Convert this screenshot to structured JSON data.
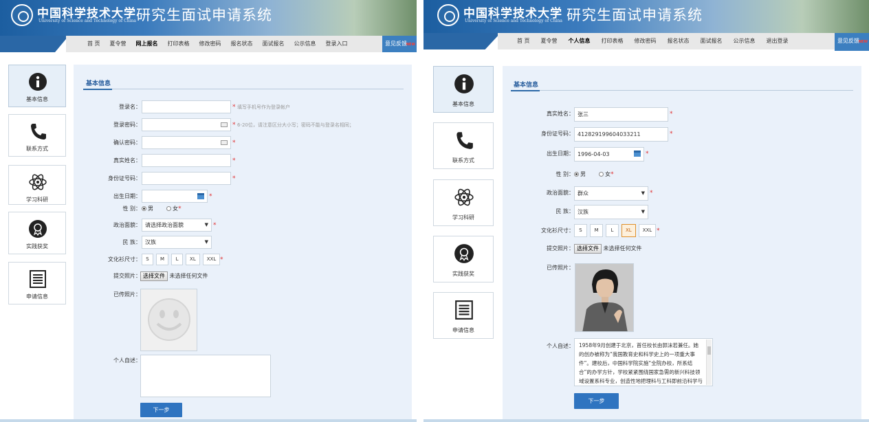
{
  "left": {
    "header": {
      "university_cn": "中国科学技术大学",
      "university_en": "University of Science and Technology of China",
      "system_title": "研究生面试申请系统"
    },
    "nav": {
      "items": [
        "首 页",
        "夏令营",
        "网上报名",
        "打印表格",
        "修改密码",
        "报名状态",
        "面试报名",
        "公示信息",
        "登录入口"
      ],
      "active_index": 2,
      "feedback": "意见反馈",
      "feedback_badge": "NEW"
    },
    "sidebar": [
      {
        "label": "基本信息",
        "icon": "info-icon"
      },
      {
        "label": "联系方式",
        "icon": "phone-icon"
      },
      {
        "label": "学习科研",
        "icon": "atom-icon"
      },
      {
        "label": "实践获奖",
        "icon": "award-icon"
      },
      {
        "label": "申请信息",
        "icon": "document-icon"
      }
    ],
    "section_title": "基本信息",
    "form": {
      "username": {
        "label": "登录名：",
        "value": "",
        "hint": "填写手机号作为登录帐户"
      },
      "password": {
        "label": "登录密码：",
        "value": "",
        "hint": "6-20位，请注意区分大小写；密码不能与登录名相同；"
      },
      "confirm_password": {
        "label": "确认密码：",
        "value": ""
      },
      "real_name": {
        "label": "真实姓名：",
        "value": ""
      },
      "id_number": {
        "label": "身份证号码：",
        "value": ""
      },
      "birth_date": {
        "label": "出生日期：",
        "value": ""
      },
      "gender": {
        "label": "性 别：",
        "options": [
          "男",
          "女"
        ],
        "selected": "男"
      },
      "political_status": {
        "label": "政治面貌：",
        "value": "请选择政治面貌"
      },
      "ethnicity": {
        "label": "民 族：",
        "value": "汉族"
      },
      "shirt_size": {
        "label": "文化衫尺寸：",
        "options": [
          "S",
          "M",
          "L",
          "XL",
          "XXL"
        ],
        "selected": ""
      },
      "upload_photo": {
        "label": "提交照片：",
        "button": "选择文件",
        "status": "未选择任何文件"
      },
      "uploaded_photo": {
        "label": "已传照片："
      },
      "self_intro": {
        "label": "个人自述：",
        "value": ""
      }
    },
    "next_button": "下一步"
  },
  "right": {
    "header": {
      "university_cn": "中国科学技术大学",
      "university_en": "University of Science and Technology of China",
      "system_title": "研究生面试申请系统"
    },
    "nav": {
      "items": [
        "首 页",
        "夏令营",
        "个人信息",
        "打印表格",
        "修改密码",
        "报名状态",
        "面试报名",
        "公示信息",
        "退出登录"
      ],
      "active_index": 2,
      "feedback": "意见反馈",
      "feedback_badge": "NEW"
    },
    "sidebar": [
      {
        "label": "基本信息",
        "icon": "info-icon"
      },
      {
        "label": "联系方式",
        "icon": "phone-icon"
      },
      {
        "label": "学习科研",
        "icon": "atom-icon"
      },
      {
        "label": "实践获奖",
        "icon": "award-icon"
      },
      {
        "label": "申请信息",
        "icon": "document-icon"
      }
    ],
    "section_title": "基本信息",
    "form": {
      "real_name": {
        "label": "真实姓名：",
        "value": "张三"
      },
      "id_number": {
        "label": "身份证号码：",
        "value": "412829199604033211"
      },
      "birth_date": {
        "label": "出生日期：",
        "value": "1996-04-03"
      },
      "gender": {
        "label": "性 别：",
        "options": [
          "男",
          "女"
        ],
        "selected": "男"
      },
      "political_status": {
        "label": "政治面貌：",
        "value": "群众"
      },
      "ethnicity": {
        "label": "民 族：",
        "value": "汉族"
      },
      "shirt_size": {
        "label": "文化衫尺寸：",
        "options": [
          "S",
          "M",
          "L",
          "XL",
          "XXL"
        ],
        "selected": "XL"
      },
      "upload_photo": {
        "label": "提交照片：",
        "button": "选择文件",
        "status": "未选择任何文件"
      },
      "uploaded_photo": {
        "label": "已传照片："
      },
      "self_intro": {
        "label": "个人自述：",
        "value": "1958年9月创建于北京，首任校长由郭沫若兼任。她的创办被称为“我国教育史和科学史上的一项重大事件”。建校后，中国科学院实施“全院办校，所系结合”的办学方针，学校紧紧围绕国家急需的新兴科技领域设置系科专业，创造性地把理科与工科即前沿科学与"
      }
    },
    "next_button": "下一步"
  },
  "colors": {
    "banner_blue": "#2a67a6",
    "content_bg": "#eaf1fa",
    "button_blue": "#2f74c0",
    "required_red": "#e03030",
    "size_selected": "#e0902a"
  }
}
